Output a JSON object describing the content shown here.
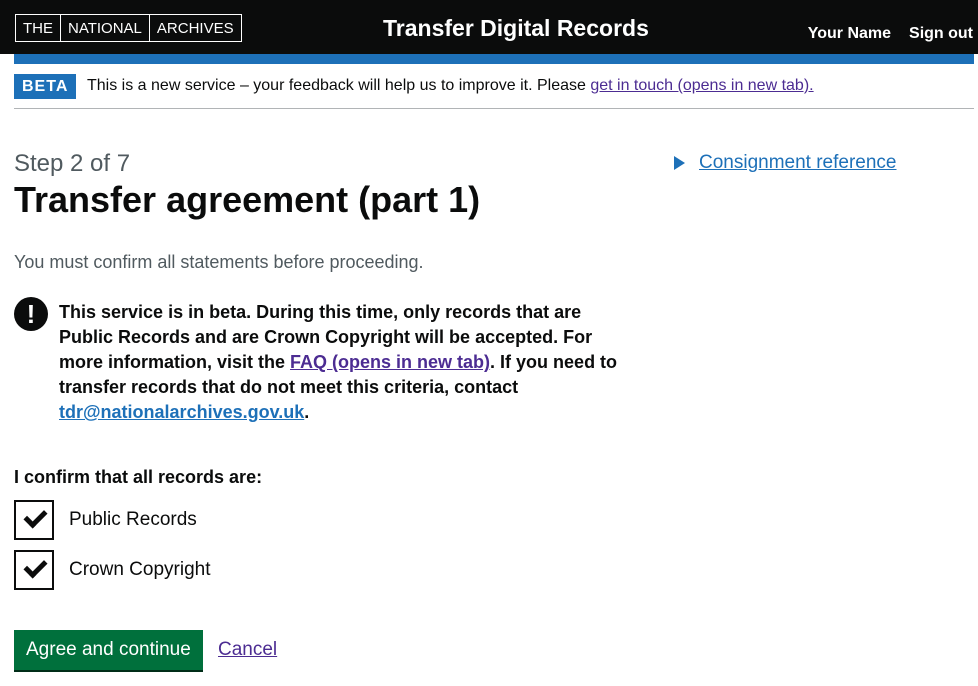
{
  "header": {
    "logo_parts": [
      "THE",
      "NATIONAL",
      "ARCHIVES"
    ],
    "service_name": "Transfer Digital Records",
    "user_name": "Your Name",
    "sign_out": "Sign out"
  },
  "beta_banner": {
    "tag": "BETA",
    "text": "This is a new service – your feedback will help us to improve it. Please ",
    "link": "get in touch (opens in new tab)."
  },
  "main": {
    "caption": "Step 2 of 7",
    "title": "Transfer agreement (part 1)",
    "hint": "You must confirm all statements before proceeding.",
    "warning": {
      "icon": "!",
      "text_1": "This service is in beta. During this time, only records that are Public Records and are Crown Copyright will be accepted. For more information, visit the ",
      "faq_link": "FAQ (opens in new tab)",
      "text_2": ". If you need to transfer records that do not meet this criteria, contact ",
      "email_link": "tdr@nationalarchives.gov.uk",
      "text_3": "."
    },
    "legend": "I confirm that all records are:",
    "checkboxes": [
      {
        "label": "Public Records",
        "checked": true
      },
      {
        "label": "Crown Copyright",
        "checked": true
      }
    ],
    "primary_button": "Agree and continue",
    "cancel_link": "Cancel"
  },
  "sidebar": {
    "details_label": "Consignment reference"
  },
  "colors": {
    "header_bg": "#0b0c0c",
    "brand_blue": "#1d70b8",
    "visited_link": "#4c2c92",
    "button_green": "#00703c"
  }
}
